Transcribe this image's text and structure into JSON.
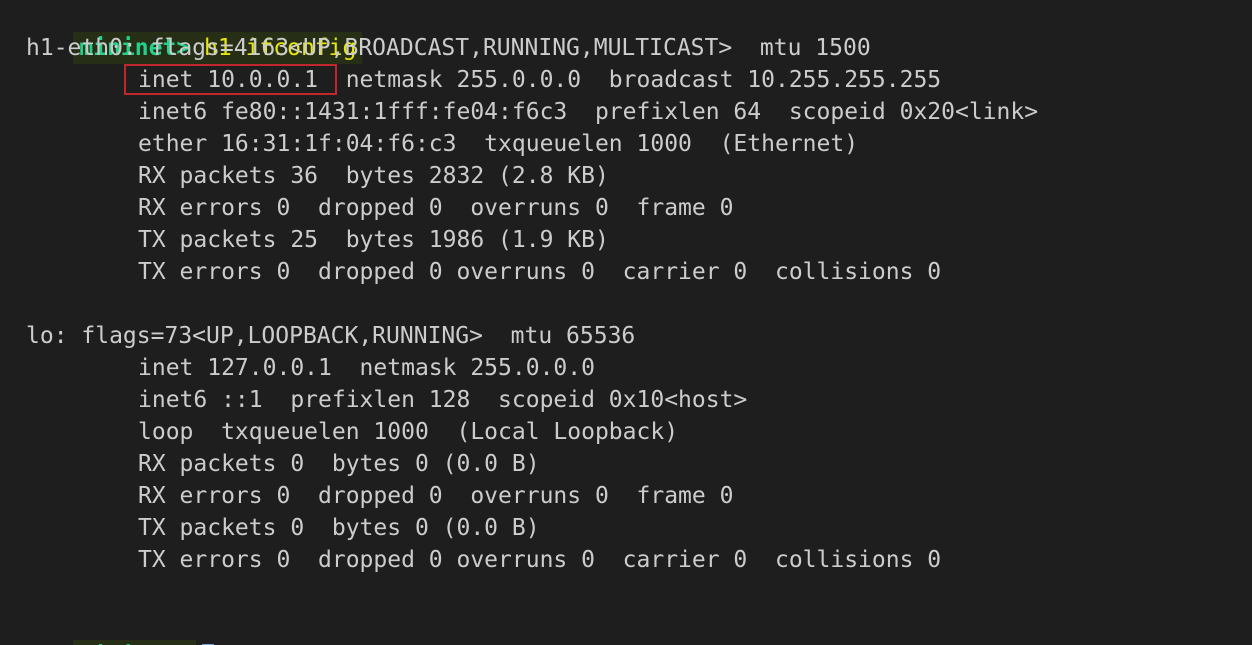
{
  "prompt": "mininet>",
  "command": "h1 ifconfig",
  "lines": [
    "h1-eth0: flags=4163<UP,BROADCAST,RUNNING,MULTICAST>  mtu 1500",
    "inet 10.0.0.1  netmask 255.0.0.0  broadcast 10.255.255.255",
    "inet6 fe80::1431:1fff:fe04:f6c3  prefixlen 64  scopeid 0x20<link>",
    "ether 16:31:1f:04:f6:c3  txqueuelen 1000  (Ethernet)",
    "RX packets 36  bytes 2832 (2.8 KB)",
    "RX errors 0  dropped 0  overruns 0  frame 0",
    "TX packets 25  bytes 1986 (1.9 KB)",
    "TX errors 0  dropped 0 overruns 0  carrier 0  collisions 0",
    "lo: flags=73<UP,LOOPBACK,RUNNING>  mtu 65536",
    "inet 127.0.0.1  netmask 255.0.0.0",
    "inet6 ::1  prefixlen 128  scopeid 0x10<host>",
    "loop  txqueuelen 1000  (Local Loopback)",
    "RX packets 0  bytes 0 (0.0 B)",
    "RX errors 0  dropped 0  overruns 0  frame 0",
    "TX packets 0  bytes 0 (0.0 B)",
    "TX errors 0  dropped 0 overruns 0  carrier 0  collisions 0"
  ],
  "colors": {
    "background": "#1e1e1e",
    "text": "#cccccc",
    "prompt": "#23d18b",
    "command": "#e5e510",
    "highlight_box": "#c0272d",
    "cursor": "#6ea6e8"
  },
  "icons": {
    "cursor": "block-cursor-icon"
  }
}
